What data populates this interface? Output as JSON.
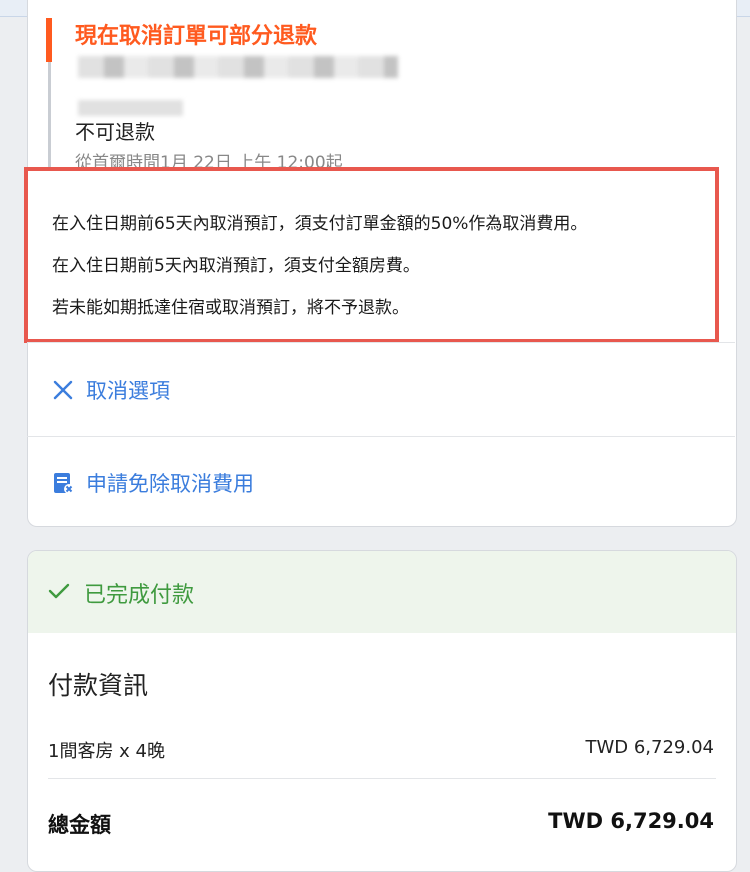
{
  "cancellation": {
    "refund_heading": "現在取消訂單可部分退款",
    "nonrefundable_title": "不可退款",
    "nonrefundable_time": "從首爾時間1月 22日 上午 12:00起",
    "policy_lines": [
      "在入住日期前65天內取消預訂，須支付訂單金額的50%作為取消費用。",
      "在入住日期前5天內取消預訂，須支付全額房費。",
      "若未能如期抵達住宿或取消預訂，將不予退款。"
    ],
    "cancel_option_label": "取消選項",
    "waive_fee_label": "申請免除取消費用"
  },
  "payment": {
    "status_label": "已完成付款",
    "section_title": "付款資訊",
    "room_label": "1間客房 x 4晚",
    "room_amount": "TWD 6,729.04",
    "total_label": "總金額",
    "total_amount": "TWD 6,729.04"
  },
  "colors": {
    "accent_orange": "#ff5a1f",
    "link_blue": "#3b7ddd",
    "success_green": "#3f9a3f",
    "highlight_red": "#e8584e"
  },
  "icons": [
    "close-icon",
    "document-cancel-icon",
    "checkmark-icon"
  ]
}
